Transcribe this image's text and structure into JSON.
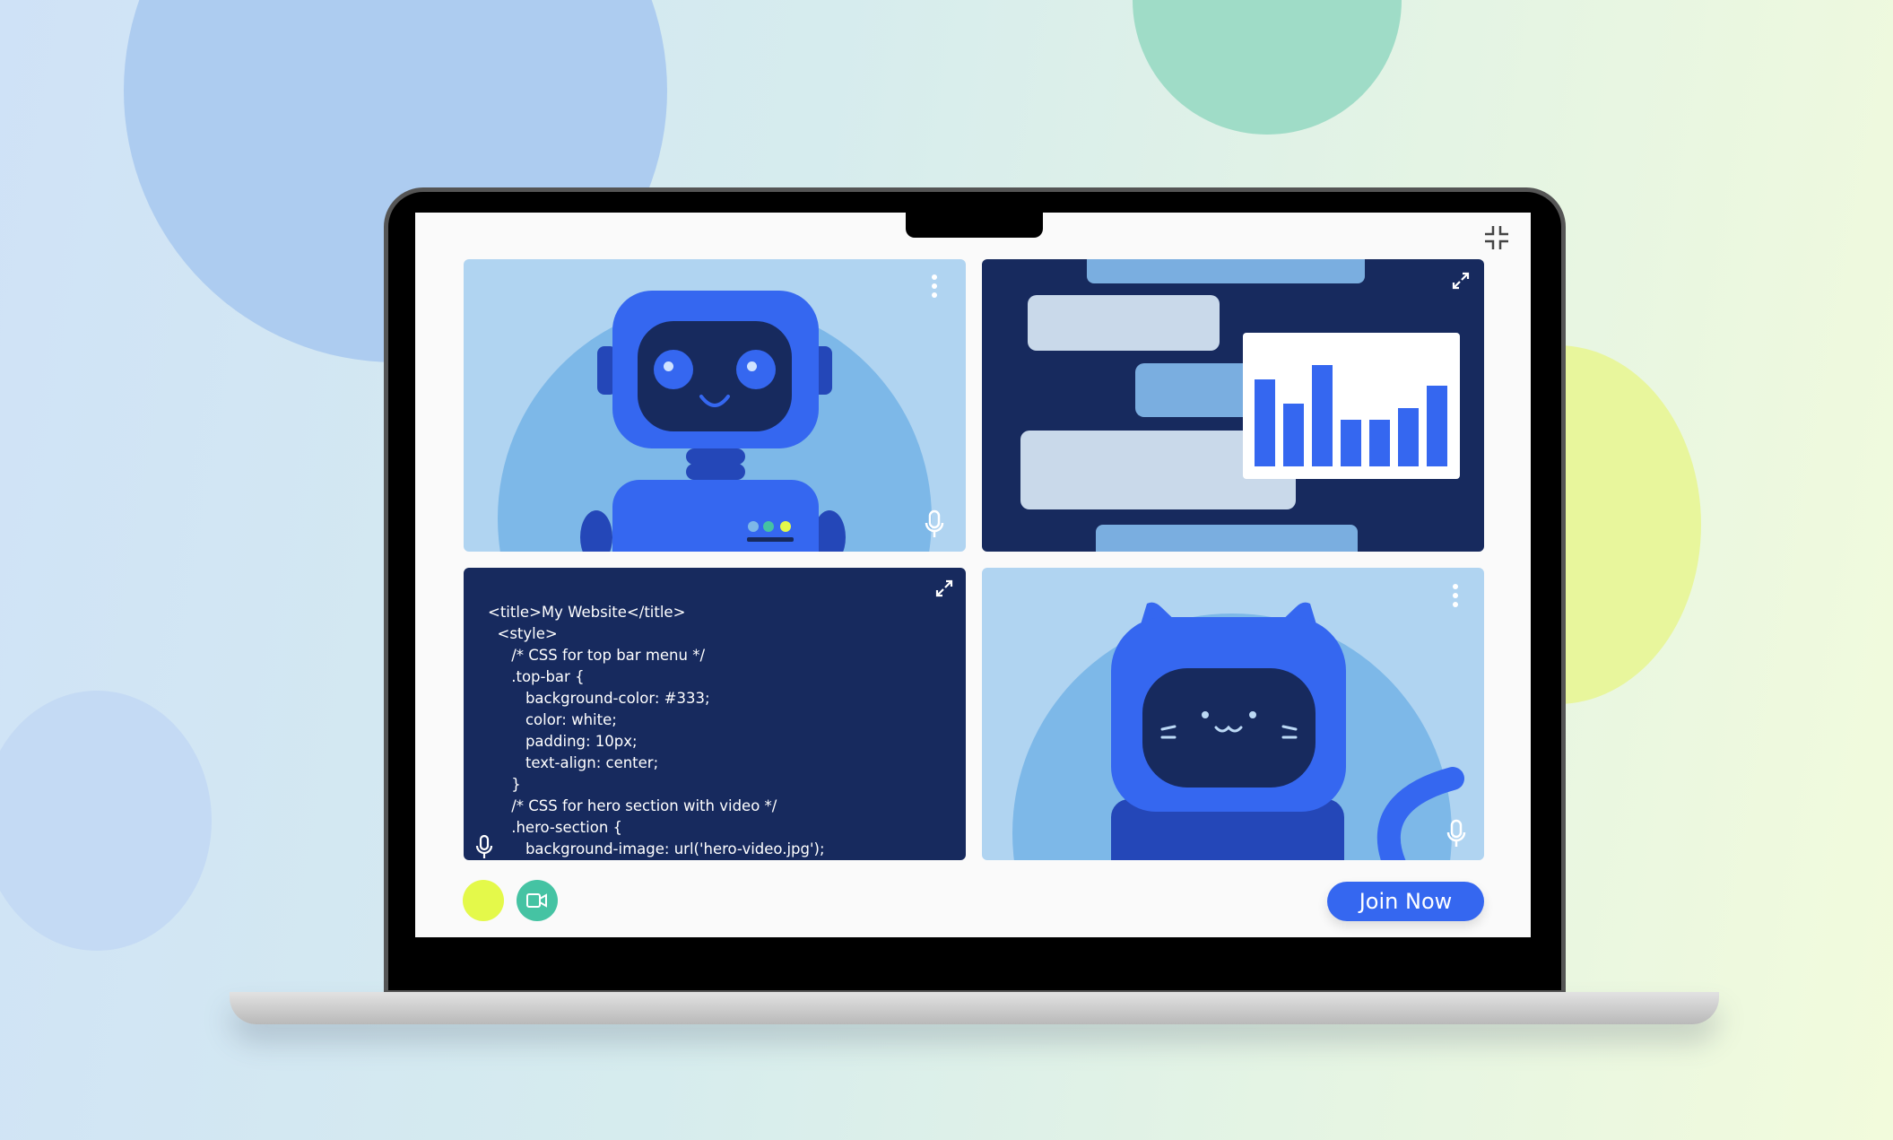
{
  "colors": {
    "navy": "#172a5e",
    "accent": "#3567f0",
    "light_blue": "#b0d4f1",
    "mid_blue": "#7db8e8",
    "mic_toggle": "#e4f94a",
    "camera_toggle": "#45c3a3"
  },
  "tiles": {
    "robot": {
      "menu_icon": "kebab-icon",
      "mic_icon": "microphone-icon"
    },
    "chat": {
      "expand_icon": "expand-icon",
      "mini_chart_levels": [
        72,
        52,
        84,
        39,
        39,
        48,
        67
      ]
    },
    "code": {
      "expand_icon": "expand-icon",
      "mic_icon": "microphone-icon",
      "lines": [
        "<title>My Website</title>",
        "  <style>",
        "     /* CSS for top bar menu */",
        "     .top-bar {",
        "        background-color: #333;",
        "        color: white;",
        "        padding: 10px;",
        "        text-align: center;",
        "     }",
        "     /* CSS for hero section with video */",
        "     .hero-section {",
        "        background-image: url('hero-video.jpg');"
      ]
    },
    "cat": {
      "menu_icon": "kebab-icon",
      "mic_icon": "microphone-icon"
    }
  },
  "controls": {
    "join_label": "Join Now",
    "exit_fullscreen_icon": "compress-icon"
  }
}
